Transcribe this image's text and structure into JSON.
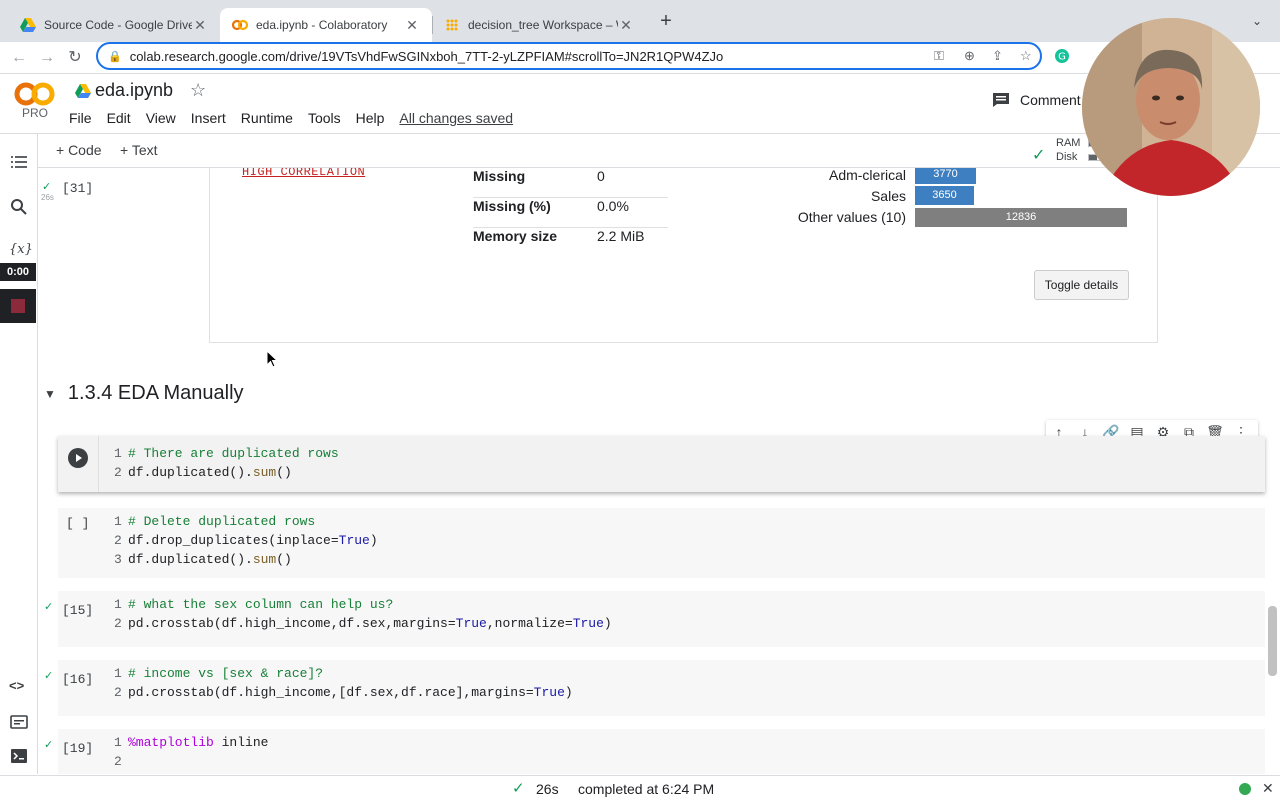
{
  "browser": {
    "tabs": [
      {
        "title": "Source Code - Google Drive",
        "active": false
      },
      {
        "title": "eda.ipynb - Colaboratory",
        "active": true
      },
      {
        "title": "decision_tree Workspace – We",
        "active": false
      }
    ],
    "url": "colab.research.google.com/drive/19VTsVhdFwSGINxboh_7TT-2-yLZPFIAM#scrollTo=JN2R1QPW4ZJo"
  },
  "colab": {
    "logo_text": "CO",
    "pro_label": "PRO",
    "notebook_title": "eda.ipynb",
    "menu": [
      "File",
      "Edit",
      "View",
      "Insert",
      "Runtime",
      "Tools",
      "Help"
    ],
    "save_status": "All changes saved",
    "comment_label": "Comment",
    "toolbar": {
      "add_code": "+ Code",
      "add_text": "+ Text"
    },
    "resources": {
      "ram_label": "RAM",
      "disk_label": "Disk",
      "ram_fraction": 0.2,
      "disk_fraction": 0.2
    }
  },
  "sidebar": {
    "timer": "0:00",
    "var_icon_text": "{x}"
  },
  "output_cell": {
    "exec_count": "[31]",
    "exec_time": "26s",
    "high_correlation_label": "HIGH CORRELATION",
    "stats": [
      {
        "key": "Missing",
        "value": "0"
      },
      {
        "key": "Missing (%)",
        "value": "0.0%"
      },
      {
        "key": "Memory size",
        "value": "2.2 MiB"
      }
    ],
    "categories": [
      {
        "label": "Adm-clerical",
        "value": "3770",
        "fraction": 0.29
      },
      {
        "label": "Sales",
        "value": "3650",
        "fraction": 0.28
      },
      {
        "label": "Other values (10)",
        "value": "12836",
        "fraction": 1.0
      }
    ],
    "toggle_label": "Toggle details"
  },
  "section": {
    "title": "1.3.4 EDA Manually"
  },
  "cells": [
    {
      "exec": "",
      "lines": [
        {
          "n": "1",
          "parts": [
            {
              "c": "cm",
              "t": "# There are duplicated rows"
            }
          ]
        },
        {
          "n": "2",
          "parts": [
            {
              "c": "",
              "t": "df.duplicated()."
            },
            {
              "c": "fn",
              "t": "sum"
            },
            {
              "c": "",
              "t": "()"
            }
          ]
        }
      ]
    },
    {
      "exec": "[ ]",
      "lines": [
        {
          "n": "1",
          "parts": [
            {
              "c": "cm",
              "t": "# Delete duplicated rows"
            }
          ]
        },
        {
          "n": "2",
          "parts": [
            {
              "c": "",
              "t": "df.drop_duplicates(inplace="
            },
            {
              "c": "kw",
              "t": "True"
            },
            {
              "c": "",
              "t": ")"
            }
          ]
        },
        {
          "n": "3",
          "parts": [
            {
              "c": "",
              "t": "df.duplicated()."
            },
            {
              "c": "fn",
              "t": "sum"
            },
            {
              "c": "",
              "t": "()"
            }
          ]
        }
      ]
    },
    {
      "exec": "[15]",
      "lines": [
        {
          "n": "1",
          "parts": [
            {
              "c": "cm",
              "t": "# what the sex column can help us?"
            }
          ]
        },
        {
          "n": "2",
          "parts": [
            {
              "c": "",
              "t": "pd.crosstab(df.high_income,df.sex,margins="
            },
            {
              "c": "kw",
              "t": "True"
            },
            {
              "c": "",
              "t": ",normalize="
            },
            {
              "c": "kw",
              "t": "True"
            },
            {
              "c": "",
              "t": ")"
            }
          ]
        }
      ]
    },
    {
      "exec": "[16]",
      "lines": [
        {
          "n": "1",
          "parts": [
            {
              "c": "cm",
              "t": "# income vs [sex & race]?"
            }
          ]
        },
        {
          "n": "2",
          "parts": [
            {
              "c": "",
              "t": "pd.crosstab(df.high_income,[df.sex,df.race],margins="
            },
            {
              "c": "kw",
              "t": "True"
            },
            {
              "c": "",
              "t": ")"
            }
          ]
        }
      ]
    },
    {
      "exec": "[19]",
      "lines": [
        {
          "n": "1",
          "parts": [
            {
              "c": "mg",
              "t": "%matplotlib"
            },
            {
              "c": "",
              "t": " inline"
            }
          ]
        },
        {
          "n": "2",
          "parts": [
            {
              "c": "",
              "t": ""
            }
          ]
        }
      ]
    }
  ],
  "status": {
    "duration": "26s",
    "message": "completed at 6:24 PM"
  },
  "colors": {
    "accent": "#1a73e8",
    "ok": "#0f9d58",
    "bar_blue": "#3d7fc1",
    "bar_gray": "#7f7f7f"
  }
}
